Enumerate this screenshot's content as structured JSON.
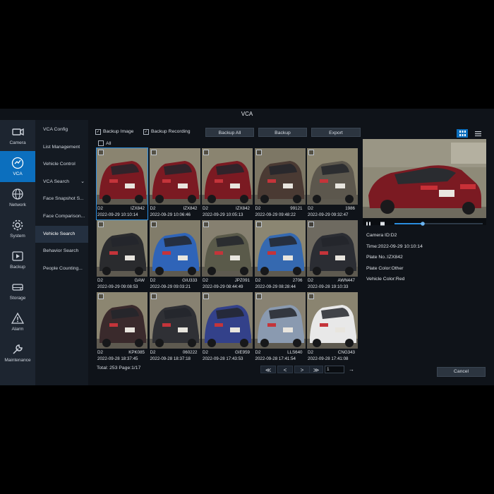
{
  "window": {
    "title": "VCA"
  },
  "mainnav": [
    {
      "label": "Camera",
      "icon": "camera-icon"
    },
    {
      "label": "VCA",
      "icon": "vca-icon",
      "active": true
    },
    {
      "label": "Network",
      "icon": "globe-icon"
    },
    {
      "label": "System",
      "icon": "gear-icon"
    },
    {
      "label": "Backup",
      "icon": "backup-icon"
    },
    {
      "label": "Storage",
      "icon": "storage-icon"
    },
    {
      "label": "Alarm",
      "icon": "alarm-icon"
    },
    {
      "label": "Maintenance",
      "icon": "wrench-icon"
    }
  ],
  "subnav": [
    {
      "label": "VCA Config"
    },
    {
      "label": "List Management"
    },
    {
      "label": "Vehicle Control"
    },
    {
      "label": "VCA Search"
    },
    {
      "label": "Face Snapshot S..."
    },
    {
      "label": "Face Comparison..."
    },
    {
      "label": "Vehicle Search",
      "active": true
    },
    {
      "label": "Behavior Search"
    },
    {
      "label": "People Counting..."
    }
  ],
  "toolbar": {
    "backup_image_label": "Backup Image",
    "backup_recording_label": "Backup Recording",
    "backup_all_label": "Backup All",
    "backup_label": "Backup",
    "export_label": "Export",
    "select_all_label": "All"
  },
  "results": [
    {
      "camera": "D2",
      "plate": "IZX842",
      "time": "2022-09-29 10:10:14",
      "car_color": "#7b1a22",
      "bg": "#8a8470",
      "selected": true
    },
    {
      "camera": "D2",
      "plate": "IZX842",
      "time": "2022-09-29 10:06:46",
      "car_color": "#7b1a22",
      "bg": "#8d8774"
    },
    {
      "camera": "D2",
      "plate": "IZX842",
      "time": "2022-09-29 10:05:13",
      "car_color": "#7b1a22",
      "bg": "#8a8470"
    },
    {
      "camera": "D2",
      "plate": "99121",
      "time": "2022-09-29 09:48:22",
      "car_color": "#4a3a33",
      "bg": "#7d7765"
    },
    {
      "camera": "D2",
      "plate": "1986",
      "time": "2022-09-29 09:32:47",
      "car_color": "#5c574d",
      "bg": "#8b8570"
    },
    {
      "camera": "D2",
      "plate": "GAW",
      "time": "2022-09-29 09:08:53",
      "car_color": "#2a2b2e",
      "bg": "#8a8672"
    },
    {
      "camera": "D2",
      "plate": "GIU333",
      "time": "2022-09-29 09:03:21",
      "car_color": "#2f64b8",
      "bg": "#817c6a"
    },
    {
      "camera": "D2",
      "plate": "JPZ091",
      "time": "2022-09-29 08:44:49",
      "car_color": "#5a5a4a",
      "bg": "#868070"
    },
    {
      "camera": "D2",
      "plate": "2706",
      "time": "2022-09-29 08:28:44",
      "car_color": "#3569b0",
      "bg": "#8b8672"
    },
    {
      "camera": "D2",
      "plate": "AWN447",
      "time": "2022-09-28 19:10:33",
      "car_color": "#2b2d33",
      "bg": "#6e6a60"
    },
    {
      "camera": "D2",
      "plate": "KPK085",
      "time": "2022-09-28 18:37:45",
      "car_color": "#3a2a2c",
      "bg": "#8c8671"
    },
    {
      "camera": "D2",
      "plate": "060222",
      "time": "2022-09-28 18:37:18",
      "car_color": "#2f3035",
      "bg": "#878171"
    },
    {
      "camera": "D2",
      "plate": "GIE959",
      "time": "2022-09-28 17:43:53",
      "car_color": "#33418a",
      "bg": "#858070"
    },
    {
      "camera": "D2",
      "plate": "LLS640",
      "time": "2022-09-28 17:41:54",
      "car_color": "#8a9ab0",
      "bg": "#888272"
    },
    {
      "camera": "D2",
      "plate": "CNG343",
      "time": "2022-09-28 17:41:08",
      "car_color": "#e8e8e8",
      "bg": "#8a8470"
    }
  ],
  "footer": {
    "total_text": "Total: 253  Page:1/17",
    "first_label": "≪",
    "prev_label": "<",
    "next_label": ">",
    "last_label": "≫",
    "page_input_value": "1",
    "go_label": "→"
  },
  "details": {
    "camera_id": "Camera ID:D2",
    "time": "Time:2022-09-29 10:10:14",
    "plate_no": "Plate No.:IZX842",
    "plate_color": "Plate Color:Other",
    "vehicle_color": "Vehicle Color:Red"
  },
  "cancel_label": "Cancel",
  "colors": {
    "accent": "#0c6fbe",
    "selection": "#2b8ee0",
    "panel": "#0f1319",
    "nav": "#1d2530"
  }
}
